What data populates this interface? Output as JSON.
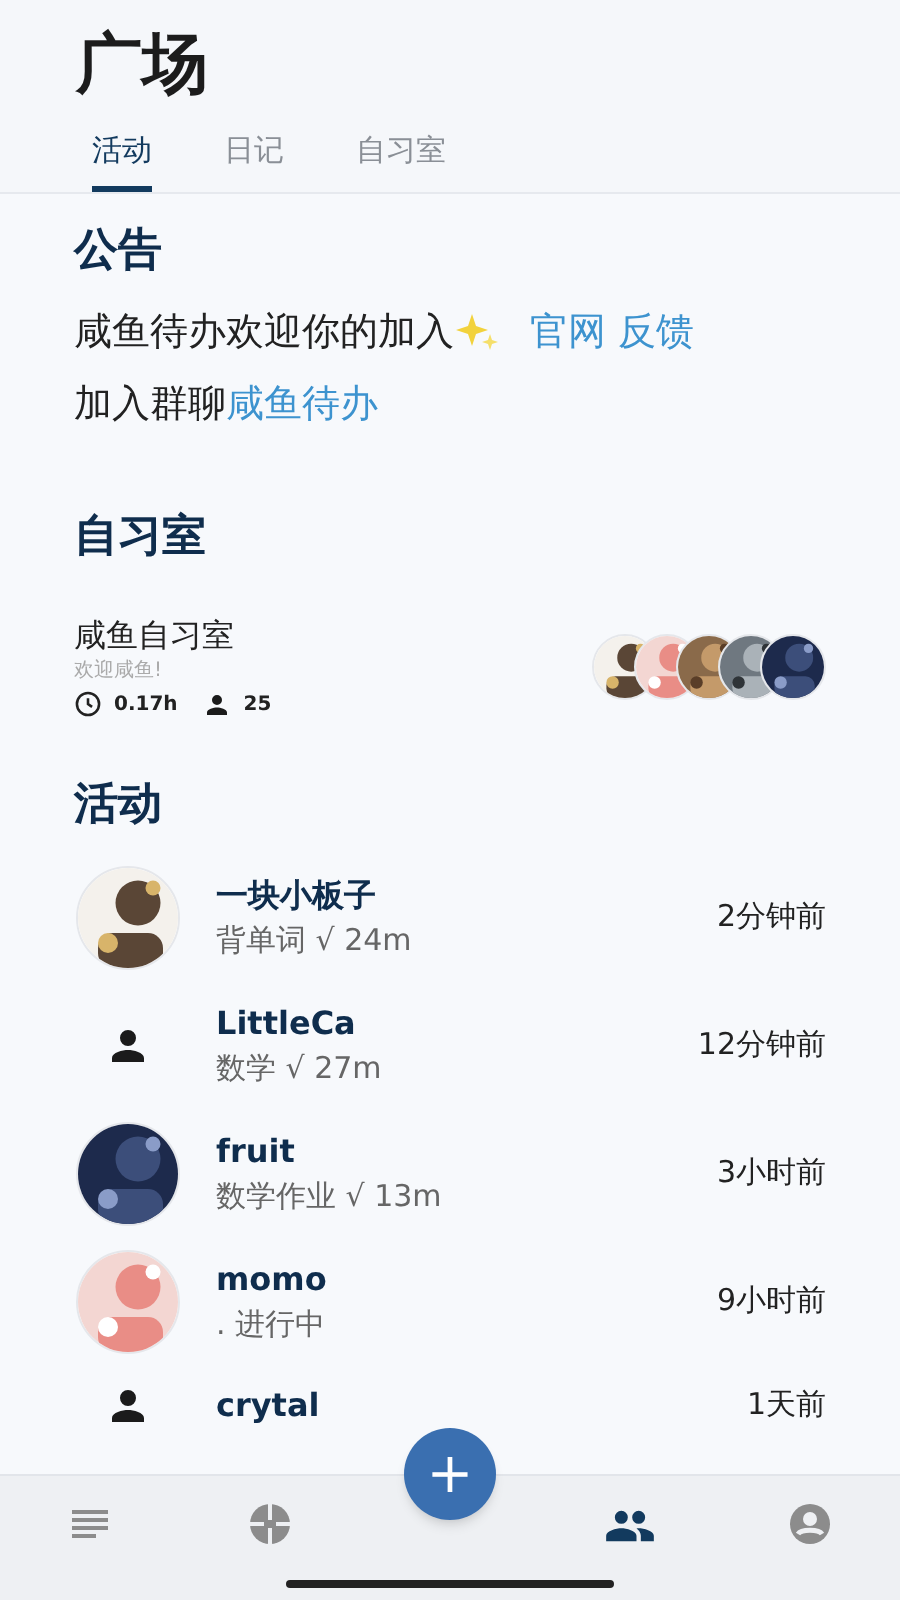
{
  "header": {
    "title": "广场",
    "tabs": [
      {
        "label": "活动",
        "selected": true
      },
      {
        "label": "日记",
        "selected": false
      },
      {
        "label": "自习室",
        "selected": false
      }
    ]
  },
  "notice": {
    "heading": "公告",
    "lines": [
      [
        {
          "kind": "text",
          "text": "咸鱼待办欢迎你的加入"
        },
        {
          "kind": "sparkle"
        },
        {
          "kind": "link",
          "text": "官网"
        },
        {
          "kind": "link",
          "text": "反馈"
        }
      ],
      [
        {
          "kind": "text",
          "text": "加入群聊"
        },
        {
          "kind": "link",
          "text": "咸鱼待办"
        }
      ]
    ]
  },
  "study_rooms": {
    "heading": "自习室",
    "rooms": [
      {
        "name": "咸鱼自习室",
        "motto": "欢迎咸鱼!",
        "hours": "0.17h",
        "members": "25"
      }
    ]
  },
  "activity": {
    "heading": "活动",
    "items": [
      {
        "name": "一块小板子",
        "detail": "背单词 √ 24m",
        "time": "2分钟前",
        "kind": "picture"
      },
      {
        "name": "LittleCa",
        "detail": "数学 √ 27m",
        "time": "12分钟前",
        "kind": "default"
      },
      {
        "name": "fruit",
        "detail": "数学作业 √ 13m",
        "time": "3小时前",
        "kind": "picture"
      },
      {
        "name": "momo",
        "detail": ". 进行中",
        "time": "9小时前",
        "kind": "picture"
      },
      {
        "name": "crytal",
        "time": "1天前",
        "kind": "default"
      }
    ]
  },
  "bottom_nav": [
    {
      "selected": false
    },
    {
      "selected": false
    },
    {
      "selected": true
    },
    {
      "selected": false
    }
  ],
  "fab": {
    "label": "+"
  }
}
